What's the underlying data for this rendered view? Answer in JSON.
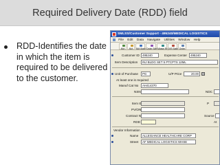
{
  "slide": {
    "title": "Required Delivery Date (RDD) field",
    "bullet": "RDD-Identifies the date in which the item is required to be delivered to the customer."
  },
  "app": {
    "title": "SMLSS/Customer Support - 495240/MEDICAL LOGISTICS",
    "menu": [
      "File",
      "Edit",
      "Data",
      "Navigate",
      "Utilities",
      "Window",
      "Help"
    ],
    "toolbar": [
      "NM",
      "NM",
      "NM Status",
      "Order Status",
      "Mbase Rcpt",
      "IVR Status",
      "Order"
    ],
    "customer_id_label": "Customer ID",
    "customer_id": "495240",
    "expense_center_label": "Expense Center",
    "expense_center": "495240",
    "item_description_label": "Item Description",
    "item_description": "INJ BLDG SET 5 PTCPTS 12ML",
    "unit_of_purchase_label": "Unit of Purchase",
    "unit_of_purchase": "PG",
    "up_price_label": "U/P Price",
    "up_price": "20.00",
    "up_price_flag": "X",
    "at_least_one": "At least one is required",
    "manuf_cat_label": "Manuf Cat No",
    "manuf_cat": "AH414370",
    "nsn_label": "NSN",
    "ndc_label": "NDC",
    "item_id_label": "Item ID",
    "pvon_label": "PV/ON",
    "contract_label": "Contract No",
    "source_label": "Source",
    "rdd_label": "RDD",
    "at_label": "At",
    "vendor_information": "Vendor Information",
    "name_label": "Name",
    "name": "ALLEGIANCE HEALTHCARE CORP",
    "street_label": "Street",
    "street": "AF MEDICAL LOGISTICS WHSE"
  }
}
